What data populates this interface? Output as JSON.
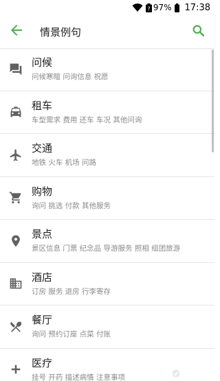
{
  "status_bar": {
    "battery_percent": "97%",
    "time": "17:38"
  },
  "app_bar": {
    "title": "情景例句",
    "back_icon": "arrow-back-icon",
    "search_icon": "search-icon",
    "accent_color": "#4caf50"
  },
  "categories": [
    {
      "title": "问候",
      "subtitle": "问候寒暄 问询信息 祝愿",
      "icon": "chat-icon"
    },
    {
      "title": "租车",
      "subtitle": "车型需求 费用 还车 车况 其他问询",
      "icon": "taxi-icon"
    },
    {
      "title": "交通",
      "subtitle": "地铁 火车 机场 问路",
      "icon": "airplane-icon"
    },
    {
      "title": "购物",
      "subtitle": "询问 挑选 付款 其他服务",
      "icon": "shopping-cart-icon"
    },
    {
      "title": "景点",
      "subtitle": "景区信息 门票 纪念品 导游服务 照相 组团旅游",
      "icon": "place-icon"
    },
    {
      "title": "酒店",
      "subtitle": "订房 服务 退房 行李寄存",
      "icon": "hotel-building-icon"
    },
    {
      "title": "餐厅",
      "subtitle": "询问 预约订座 点菜 付账",
      "icon": "restaurant-icon"
    },
    {
      "title": "医疗",
      "subtitle": "挂号 开药 描述病情 注意事项",
      "icon": "medical-plus-icon"
    }
  ],
  "colors": {
    "icon": "#616161",
    "subtitle": "#8a8a8a",
    "divider": "#e6e6e6"
  }
}
